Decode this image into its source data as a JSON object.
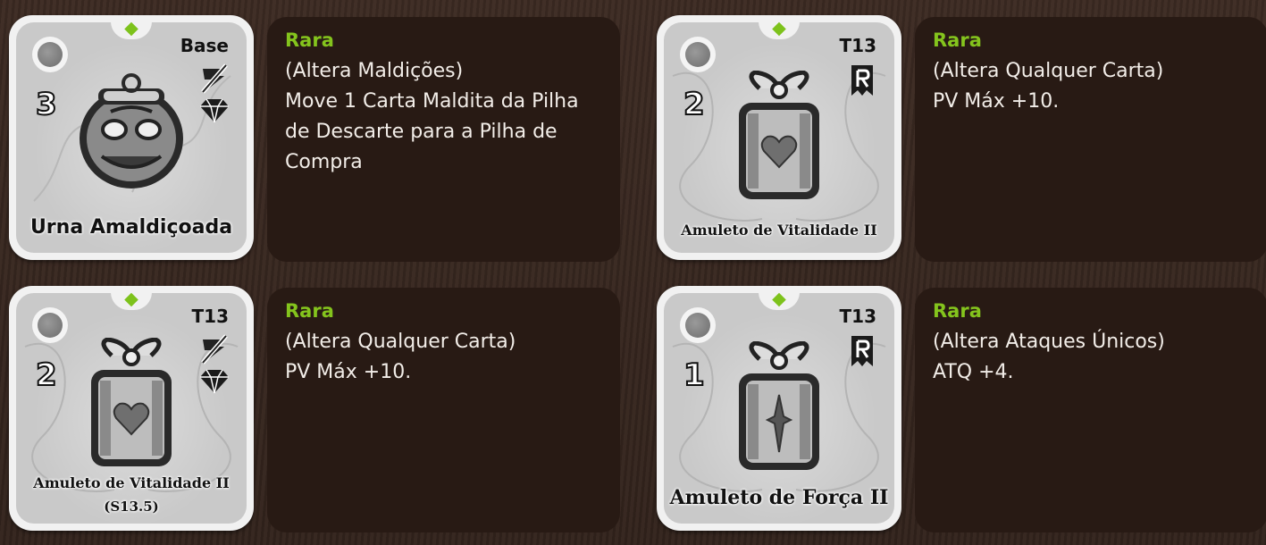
{
  "cards": [
    {
      "tier": "Base",
      "cost": "3",
      "name": "Urna Amaldiçoada",
      "name_sub": "",
      "art": "urn-icon",
      "badges": [
        "no-action-icon",
        "diamond-icon"
      ],
      "rarity": "Rara",
      "effect": "(Altera Maldições)\nMove 1 Carta Maldita da Pilha de Descarte para a Pilha de Compra"
    },
    {
      "tier": "T13",
      "cost": "2",
      "name": "Amuleto de Vitalidade II",
      "name_sub": "",
      "art": "heart-amulet-icon",
      "badges": [
        "rune-r-icon"
      ],
      "rarity": "Rara",
      "effect": "(Altera Qualquer Carta)\nPV Máx +10."
    },
    {
      "tier": "T13",
      "cost": "2",
      "name": "Amuleto de Vitalidade II",
      "name_sub": "(S13.5)",
      "art": "heart-amulet-icon",
      "badges": [
        "no-action-icon",
        "diamond-icon"
      ],
      "rarity": "Rara",
      "effect": "(Altera Qualquer Carta)\nPV Máx +10."
    },
    {
      "tier": "T13",
      "cost": "1",
      "name": "Amuleto de Força II",
      "name_sub": "",
      "art": "sword-amulet-icon",
      "badges": [
        "rune-r-icon"
      ],
      "rarity": "Rara",
      "effect": "(Altera Ataques Únicos)\nATQ +4."
    }
  ],
  "colors": {
    "rarity": "#84c41d",
    "panel": "#281a14",
    "card": "#c9c9c9"
  }
}
